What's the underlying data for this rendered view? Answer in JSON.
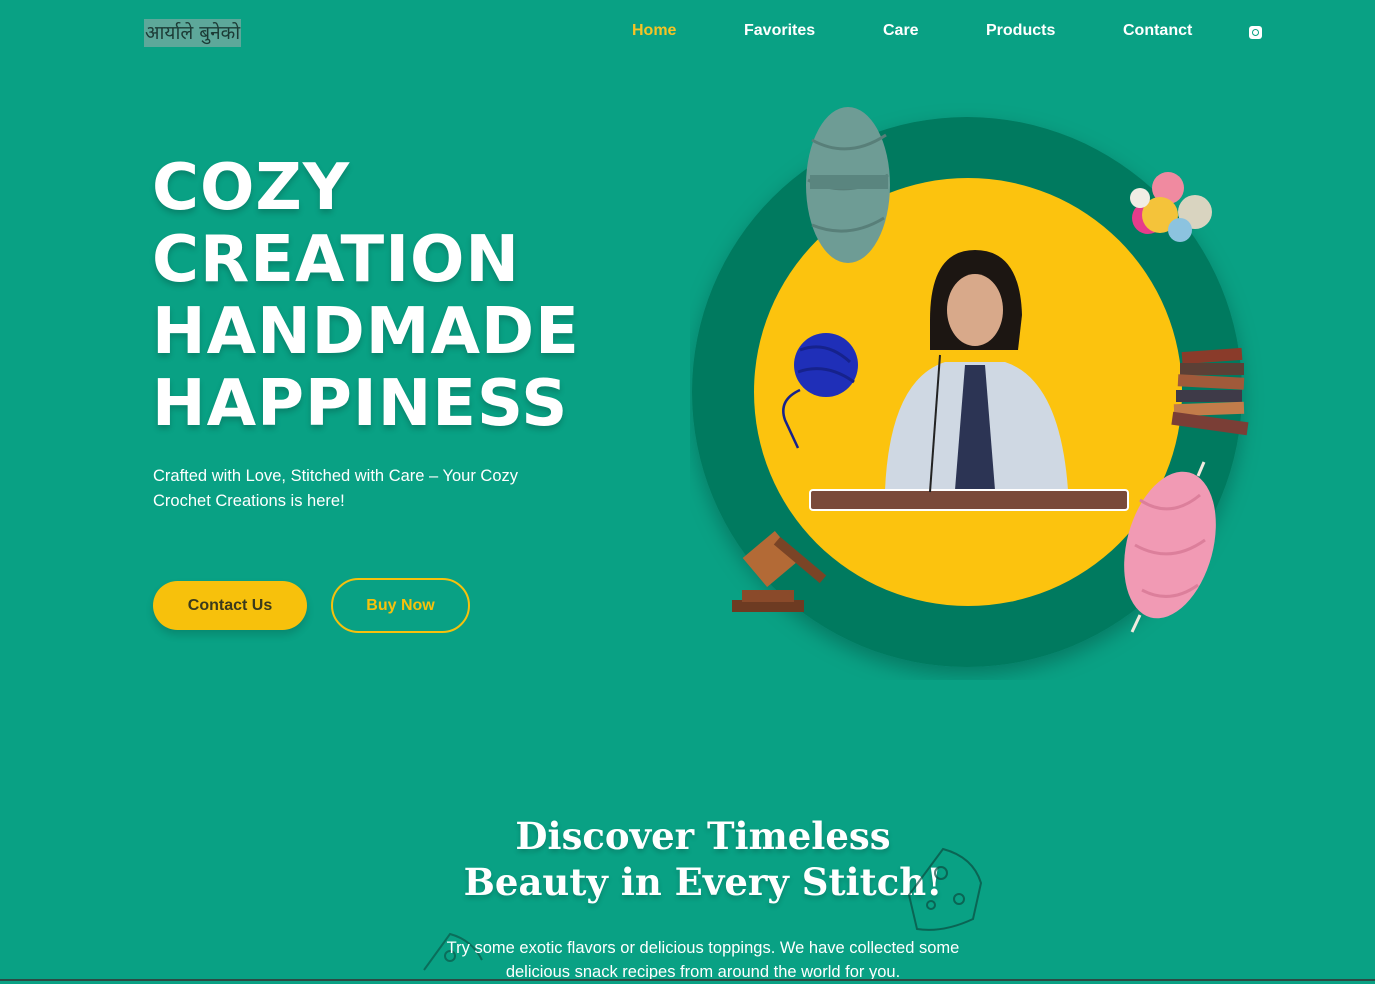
{
  "header": {
    "logo_text": "आर्याले बुनेको",
    "nav": [
      {
        "label": "Home",
        "active": true
      },
      {
        "label": "Favorites",
        "active": false
      },
      {
        "label": "Care",
        "active": false
      },
      {
        "label": "Products",
        "active": false
      },
      {
        "label": "Contanct",
        "active": false
      }
    ],
    "social_icon": "instagram-icon"
  },
  "hero": {
    "title_lines": [
      "COZY",
      "CREATION",
      "HANDMADE",
      "HAPPINESS"
    ],
    "subtitle": "Crafted with Love, Stitched with Care – Your Cozy Crochet Creations is here!",
    "contact_button": "Contact Us",
    "buy_button": "Buy Now"
  },
  "section": {
    "title_line1": "Discover Timeless",
    "title_line2": "Beauty in Every Stitch!",
    "text": "Try some exotic flavors or delicious toppings. We have collected some delicious snack recipes from around the world for you."
  },
  "colors": {
    "background": "#09a184",
    "accent": "#f7c10c",
    "ring": "#057a5f",
    "inner_circle": "#fcc30e"
  }
}
